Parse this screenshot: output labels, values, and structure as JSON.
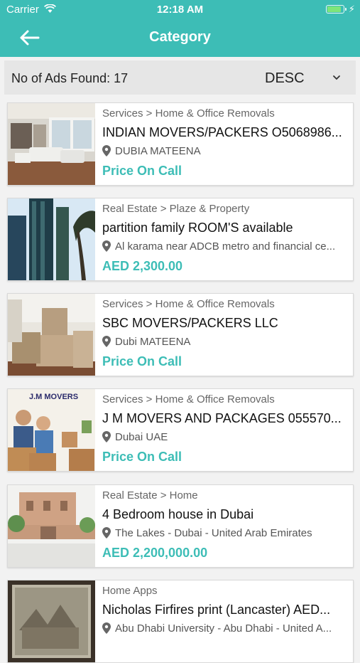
{
  "status_bar": {
    "carrier": "Carrier",
    "time": "12:18 AM"
  },
  "header": {
    "title": "Category"
  },
  "filter": {
    "count_label": "No of Ads Found: 17",
    "sort_value": "DESC"
  },
  "colors": {
    "accent": "#3dbdb6"
  },
  "ads": [
    {
      "category": "Services > Home & Office Removals",
      "title": "INDIAN MOVERS/PACKERS O5068986...",
      "location": "DUBIA MATEENA",
      "price": "Price On Call"
    },
    {
      "category": "Real Estate > Plaze & Property",
      "title": "partition family ROOM'S available",
      "location": "Al karama near ADCB metro and financial ce...",
      "price": "AED 2,300.00"
    },
    {
      "category": "Services > Home & Office Removals",
      "title": "SBC MOVERS/PACKERS LLC",
      "location": "Dubi MATEENA",
      "price": "Price On Call"
    },
    {
      "category": "Services > Home & Office Removals",
      "title": "J M MOVERS AND PACKAGES 055570...",
      "location": "Dubai UAE",
      "price": "Price On Call",
      "thumb_text": "J.M MOVERS"
    },
    {
      "category": "Real Estate > Home",
      "title": "4 Bedroom house in Dubai",
      "location": "The Lakes - Dubai - United Arab Emirates",
      "price": "AED 2,200,000.00"
    },
    {
      "category": "Home Apps",
      "title": "Nicholas Firfires print (Lancaster) AED...",
      "location": "Abu Dhabi University - Abu Dhabi - United A...",
      "price": ""
    }
  ]
}
